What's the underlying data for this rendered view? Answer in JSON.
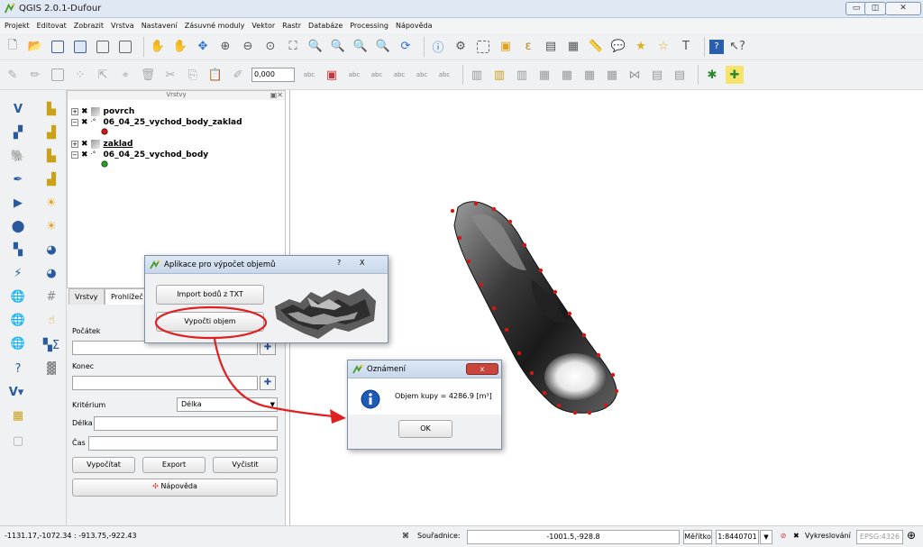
{
  "window": {
    "title": "QGIS 2.0.1-Dufour"
  },
  "menu": [
    "Projekt",
    "Editovat",
    "Zobrazit",
    "Vrstva",
    "Nastavení",
    "Zásuvné moduly",
    "Vektor",
    "Rastr",
    "Databáze",
    "Processing",
    "Nápověda"
  ],
  "toolbar2": {
    "scale_value": "0,000"
  },
  "layers_panel": {
    "title": "Vrstvy",
    "layers": [
      {
        "name": "povrch"
      },
      {
        "name": "06_04_25_vychod_body_zaklad"
      },
      {
        "name": "zaklad"
      },
      {
        "name": "06_04_25_vychod_body"
      }
    ]
  },
  "dock": {
    "tabs": [
      "Vrstvy",
      "Prohlížeč"
    ],
    "start_label": "Počátek",
    "end_label": "Konec",
    "criterion_label": "Kritérium",
    "criterion_value": "Délka",
    "length_label": "Délka",
    "time_label": "Čas",
    "calculate_button": "Vypočítat",
    "export_button": "Export",
    "clear_button": "Vyčistit",
    "help_button": "Nápověda"
  },
  "app_dialog": {
    "title": "Aplikace pro výpočet objemů",
    "help_glyph": "?",
    "close_glyph": "X",
    "import_button": "Import bodů z TXT",
    "compute_button": "Vypočti objem"
  },
  "message_box": {
    "title": "Oznámení",
    "message": "Objem kupy = 4286.9 [m³]",
    "ok_button": "OK",
    "close_glyph": "x"
  },
  "statusbar": {
    "extents": "-1131.17,-1072.34 : -913.75,-922.43",
    "coord_label": "Souřadnice:",
    "coord_value": "-1001.5,-928.8",
    "scale_label": "Měřítko",
    "scale_value": "1:8440701",
    "render_label": "Vykreslování",
    "crs": "EPSG:4326"
  },
  "colors": {
    "annotation_red": "#e02020",
    "point_red": "#d01818",
    "point_green": "#2a9a2a",
    "info_blue": "#1d5bb8"
  }
}
